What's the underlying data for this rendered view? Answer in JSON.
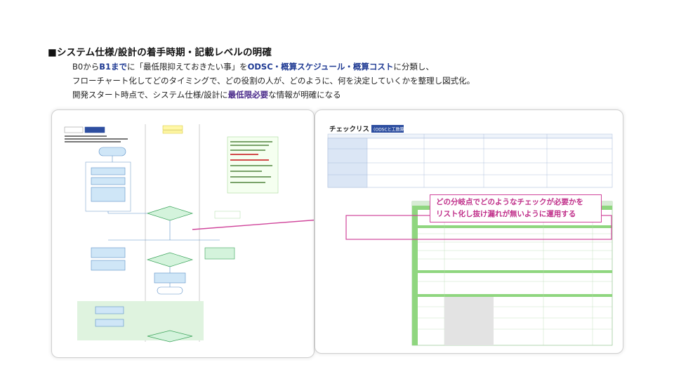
{
  "heading": "■システム仕様/設計の着手時期・記載レベルの明確",
  "line1": {
    "a": "B0から",
    "b": "B1まで",
    "c": "に「最低限抑えておきたい事」を",
    "d": "ODSC・概算スケジュール・概算コスト",
    "e": "に分類し、"
  },
  "line2": "フローチャート化してどのタイミングで、どの役割の人が、どのように、何を決定していくかを整理し図式化。",
  "line3": {
    "a": "開発スタート時点で、システム仕様/設計に",
    "b": "最低限必要",
    "c": "な情報が明確になる"
  },
  "callout": {
    "line1": "どの分岐点でどのようなチェックが必要かを",
    "line2": "リスト化し抜け漏れが無いように運用する"
  },
  "checklist": {
    "title": "チェックリスト",
    "tag": "(ODSCと工数算出)"
  },
  "colors": {
    "accent_blue": "#1f3a93",
    "callout_pink": "#d0459b",
    "flow_box_fill": "#cfe6f7",
    "flow_decision_fill": "#d4f3dc",
    "table_green": "#8fd67f"
  }
}
